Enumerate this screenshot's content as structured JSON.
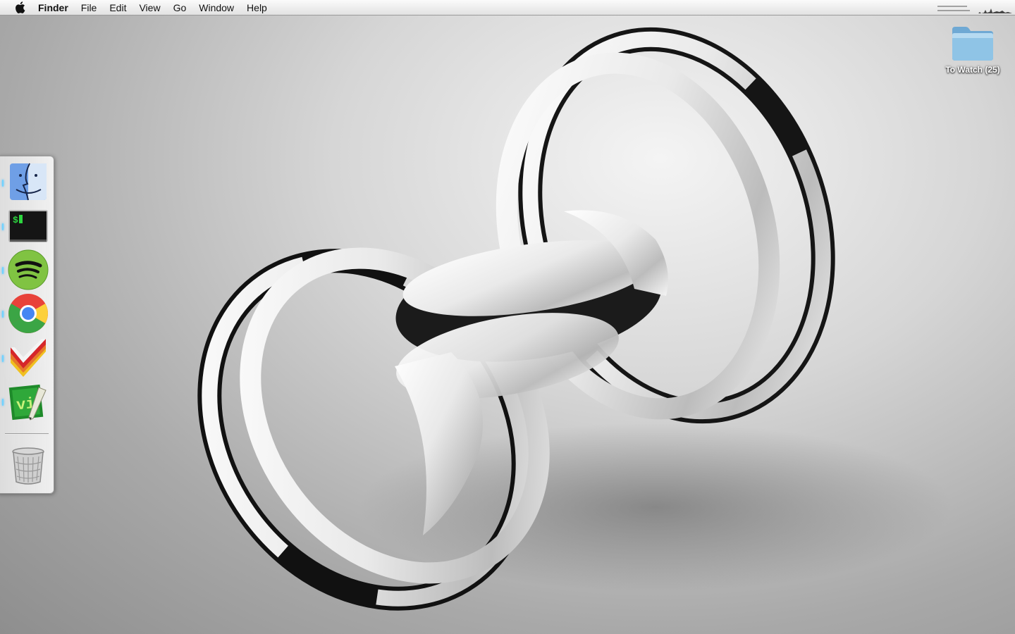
{
  "menubar": {
    "apple_icon": "apple-logo-icon",
    "app_name": "Finder",
    "items": [
      "File",
      "Edit",
      "View",
      "Go",
      "Window",
      "Help"
    ]
  },
  "desktop": {
    "icons": [
      {
        "label": "To Watch (25)",
        "icon": "folder-icon"
      }
    ]
  },
  "dock": {
    "items": [
      {
        "icon": "finder-icon",
        "running": true
      },
      {
        "icon": "terminal-icon",
        "running": true
      },
      {
        "icon": "spotify-icon",
        "running": true
      },
      {
        "icon": "chrome-icon",
        "running": true
      },
      {
        "icon": "todo-checkmark-icon",
        "running": true
      },
      {
        "icon": "vim-icon",
        "running": true
      },
      {
        "icon": "trash-icon",
        "running": false
      }
    ]
  },
  "colors": {
    "menubar": "#ececec",
    "wallpaper": "#bdbdbd",
    "dock_background": "#ececec",
    "running_indicator": "#6fd3ff",
    "folder_blue": "#8fc4e6"
  }
}
